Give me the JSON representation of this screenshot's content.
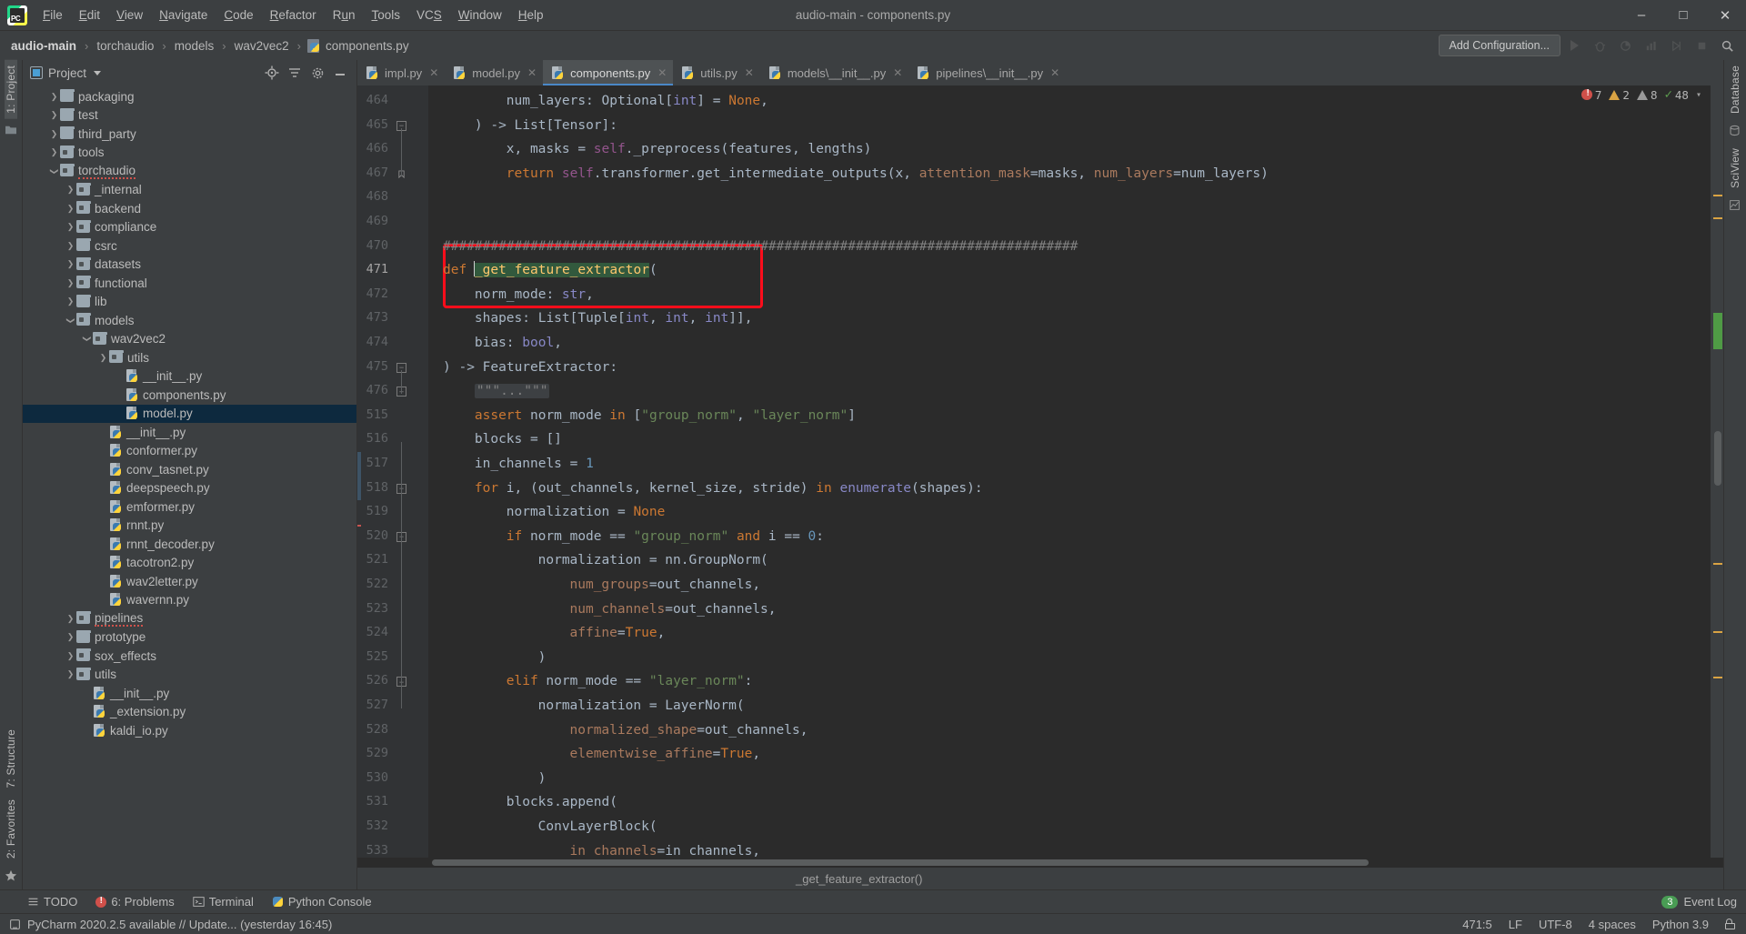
{
  "window": {
    "title": "audio-main - components.py",
    "minimize": "–",
    "maximize": "□",
    "close": "✕"
  },
  "menu": [
    {
      "label": "File"
    },
    {
      "label": "Edit"
    },
    {
      "label": "View"
    },
    {
      "label": "Navigate"
    },
    {
      "label": "Code"
    },
    {
      "label": "Refactor"
    },
    {
      "label": "Run"
    },
    {
      "label": "Tools"
    },
    {
      "label": "VCS"
    },
    {
      "label": "Window"
    },
    {
      "label": "Help"
    }
  ],
  "breadcrumb": {
    "items": [
      "audio-main",
      "torchaudio",
      "models",
      "wav2vec2",
      "components.py"
    ],
    "separator": "›"
  },
  "navbar": {
    "add_configuration": "Add Configuration...",
    "icons": [
      "run-icon",
      "debug-icon",
      "run-coverage-icon",
      "profile-icon",
      "run-with-icon",
      "stop-icon",
      "search-everywhere-icon"
    ]
  },
  "left_rail": {
    "project_label": "1: Project",
    "structure_label": "7: Structure",
    "favorites_label": "2: Favorites"
  },
  "project_panel": {
    "title": "Project",
    "actions": [
      "locate-icon",
      "collapse-all-icon",
      "settings-icon",
      "hide-icon"
    ],
    "tree": [
      {
        "label": "packaging",
        "depth": 1,
        "type": "folder",
        "state": "collapsed"
      },
      {
        "label": "test",
        "depth": 1,
        "type": "folder",
        "state": "collapsed"
      },
      {
        "label": "third_party",
        "depth": 1,
        "type": "folder",
        "state": "collapsed"
      },
      {
        "label": "tools",
        "depth": 1,
        "type": "source",
        "state": "collapsed"
      },
      {
        "label": "torchaudio",
        "depth": 1,
        "type": "source",
        "state": "expanded",
        "spell": true
      },
      {
        "label": "_internal",
        "depth": 2,
        "type": "source",
        "state": "collapsed"
      },
      {
        "label": "backend",
        "depth": 2,
        "type": "source",
        "state": "collapsed"
      },
      {
        "label": "compliance",
        "depth": 2,
        "type": "source",
        "state": "collapsed"
      },
      {
        "label": "csrc",
        "depth": 2,
        "type": "folder",
        "state": "collapsed"
      },
      {
        "label": "datasets",
        "depth": 2,
        "type": "source",
        "state": "collapsed"
      },
      {
        "label": "functional",
        "depth": 2,
        "type": "source",
        "state": "collapsed"
      },
      {
        "label": "lib",
        "depth": 2,
        "type": "folder",
        "state": "collapsed"
      },
      {
        "label": "models",
        "depth": 2,
        "type": "source",
        "state": "expanded"
      },
      {
        "label": "wav2vec2",
        "depth": 3,
        "type": "source",
        "state": "expanded"
      },
      {
        "label": "utils",
        "depth": 4,
        "type": "source",
        "state": "collapsed"
      },
      {
        "label": "__init__.py",
        "depth": 5,
        "type": "python",
        "state": "leaf"
      },
      {
        "label": "components.py",
        "depth": 5,
        "type": "python",
        "state": "leaf"
      },
      {
        "label": "model.py",
        "depth": 5,
        "type": "python",
        "state": "leaf",
        "selected": true
      },
      {
        "label": "__init__.py",
        "depth": 4,
        "type": "python",
        "state": "leaf"
      },
      {
        "label": "conformer.py",
        "depth": 4,
        "type": "python",
        "state": "leaf"
      },
      {
        "label": "conv_tasnet.py",
        "depth": 4,
        "type": "python",
        "state": "leaf"
      },
      {
        "label": "deepspeech.py",
        "depth": 4,
        "type": "python",
        "state": "leaf"
      },
      {
        "label": "emformer.py",
        "depth": 4,
        "type": "python",
        "state": "leaf"
      },
      {
        "label": "rnnt.py",
        "depth": 4,
        "type": "python",
        "state": "leaf"
      },
      {
        "label": "rnnt_decoder.py",
        "depth": 4,
        "type": "python",
        "state": "leaf"
      },
      {
        "label": "tacotron2.py",
        "depth": 4,
        "type": "python",
        "state": "leaf"
      },
      {
        "label": "wav2letter.py",
        "depth": 4,
        "type": "python",
        "state": "leaf"
      },
      {
        "label": "wavernn.py",
        "depth": 4,
        "type": "python",
        "state": "leaf"
      },
      {
        "label": "pipelines",
        "depth": 2,
        "type": "source",
        "state": "collapsed",
        "spell": true
      },
      {
        "label": "prototype",
        "depth": 2,
        "type": "folder",
        "state": "collapsed"
      },
      {
        "label": "sox_effects",
        "depth": 2,
        "type": "source",
        "state": "collapsed"
      },
      {
        "label": "utils",
        "depth": 2,
        "type": "source",
        "state": "collapsed"
      },
      {
        "label": "__init__.py",
        "depth": 3,
        "type": "python",
        "state": "leaf"
      },
      {
        "label": "_extension.py",
        "depth": 3,
        "type": "python",
        "state": "leaf"
      },
      {
        "label": "kaldi_io.py",
        "depth": 3,
        "type": "python",
        "state": "leaf"
      }
    ]
  },
  "editor": {
    "tabs": [
      {
        "label": "impl.py",
        "active": false
      },
      {
        "label": "model.py",
        "active": false
      },
      {
        "label": "components.py",
        "active": true
      },
      {
        "label": "utils.py",
        "active": false
      },
      {
        "label": "models\\__init__.py",
        "active": false
      },
      {
        "label": "pipelines\\__init__.py",
        "active": false
      }
    ],
    "inspection": {
      "errors": "7",
      "warnings": "2",
      "weak_warnings": "8",
      "ok_count": "48"
    },
    "bottom_breadcrumb": "_get_feature_extractor()",
    "lines": [
      {
        "n": "464",
        "indent": 8,
        "fold": "",
        "tokens": [
          {
            "t": "num_layers: ",
            "c": "plain"
          },
          {
            "t": "Optional",
            "c": "plain"
          },
          {
            "t": "[",
            "c": "plain"
          },
          {
            "t": "int",
            "c": "builtin"
          },
          {
            "t": "] = ",
            "c": "plain"
          },
          {
            "t": "None",
            "c": "kw"
          },
          {
            "t": ",",
            "c": "plain"
          }
        ]
      },
      {
        "n": "465",
        "indent": 4,
        "fold": "minus",
        "tokens": [
          {
            "t": ") -> List[Tensor]:",
            "c": "plain"
          }
        ]
      },
      {
        "n": "466",
        "indent": 8,
        "fold": "",
        "tokens": [
          {
            "t": "x, masks = ",
            "c": "plain"
          },
          {
            "t": "self",
            "c": "self"
          },
          {
            "t": "._preprocess(features, lengths)",
            "c": "plain"
          }
        ]
      },
      {
        "n": "467",
        "indent": 8,
        "fold": "end",
        "tokens": [
          {
            "t": "return ",
            "c": "kw"
          },
          {
            "t": "self",
            "c": "self"
          },
          {
            "t": ".transformer.get_intermediate_outputs(x, ",
            "c": "plain"
          },
          {
            "t": "attention_mask",
            "c": "param"
          },
          {
            "t": "=masks, ",
            "c": "plain"
          },
          {
            "t": "num_layers",
            "c": "param"
          },
          {
            "t": "=num_layers)",
            "c": "plain"
          }
        ]
      },
      {
        "n": "468",
        "indent": 0,
        "fold": "",
        "tokens": []
      },
      {
        "n": "469",
        "indent": 0,
        "fold": "",
        "tokens": []
      },
      {
        "n": "470",
        "indent": 0,
        "fold": "",
        "tokens": [
          {
            "t": "################################################################################",
            "c": "comment"
          }
        ]
      },
      {
        "n": "471",
        "indent": 0,
        "fold": "",
        "cur": true,
        "tokens": [
          {
            "t": "def ",
            "c": "kw"
          },
          {
            "t": "_get_feature_extractor",
            "c": "defhl"
          },
          {
            "t": "(",
            "c": "plain"
          }
        ]
      },
      {
        "n": "472",
        "indent": 4,
        "fold": "",
        "tokens": [
          {
            "t": "norm_mode: ",
            "c": "plain"
          },
          {
            "t": "str",
            "c": "builtin"
          },
          {
            "t": ",",
            "c": "plain"
          }
        ]
      },
      {
        "n": "473",
        "indent": 4,
        "fold": "",
        "tokens": [
          {
            "t": "shapes: List[Tuple[",
            "c": "plain"
          },
          {
            "t": "int",
            "c": "builtin"
          },
          {
            "t": ", ",
            "c": "plain"
          },
          {
            "t": "int",
            "c": "builtin"
          },
          {
            "t": ", ",
            "c": "plain"
          },
          {
            "t": "int",
            "c": "builtin"
          },
          {
            "t": "]],",
            "c": "plain"
          }
        ]
      },
      {
        "n": "474",
        "indent": 4,
        "fold": "",
        "tokens": [
          {
            "t": "bias: ",
            "c": "plain"
          },
          {
            "t": "bool",
            "c": "builtin"
          },
          {
            "t": ",",
            "c": "plain"
          }
        ]
      },
      {
        "n": "475",
        "indent": 0,
        "fold": "minus",
        "tokens": [
          {
            "t": ") -> FeatureExtractor:",
            "c": "plain"
          }
        ]
      },
      {
        "n": "476",
        "indent": 4,
        "fold": "plus",
        "tokens": [
          {
            "t": "\"\"\"...\"\"\"",
            "c": "folded"
          }
        ]
      },
      {
        "n": "515",
        "indent": 4,
        "fold": "",
        "tokens": [
          {
            "t": "assert ",
            "c": "kw"
          },
          {
            "t": "norm_mode ",
            "c": "plain"
          },
          {
            "t": "in ",
            "c": "kw"
          },
          {
            "t": "[",
            "c": "plain"
          },
          {
            "t": "\"group_norm\"",
            "c": "str"
          },
          {
            "t": ", ",
            "c": "plain"
          },
          {
            "t": "\"layer_norm\"",
            "c": "str"
          },
          {
            "t": "]",
            "c": "plain"
          }
        ]
      },
      {
        "n": "516",
        "indent": 4,
        "fold": "",
        "tokens": [
          {
            "t": "blocks = []",
            "c": "plain"
          }
        ]
      },
      {
        "n": "517",
        "indent": 4,
        "fold": "",
        "tokens": [
          {
            "t": "in_channels = ",
            "c": "plain"
          },
          {
            "t": "1",
            "c": "num"
          }
        ]
      },
      {
        "n": "518",
        "indent": 4,
        "fold": "minus",
        "tokens": [
          {
            "t": "for ",
            "c": "kw"
          },
          {
            "t": "i, (out_channels, kernel_size, stride) ",
            "c": "plain"
          },
          {
            "t": "in ",
            "c": "kw"
          },
          {
            "t": "enumerate",
            "c": "builtin"
          },
          {
            "t": "(shapes):",
            "c": "plain"
          }
        ]
      },
      {
        "n": "519",
        "indent": 8,
        "fold": "",
        "tokens": [
          {
            "t": "normalization = ",
            "c": "plain"
          },
          {
            "t": "None",
            "c": "kw"
          }
        ]
      },
      {
        "n": "520",
        "indent": 8,
        "fold": "minus",
        "tokens": [
          {
            "t": "if ",
            "c": "kw"
          },
          {
            "t": "norm_mode == ",
            "c": "plain"
          },
          {
            "t": "\"group_norm\"",
            "c": "str"
          },
          {
            "t": " and ",
            "c": "kw"
          },
          {
            "t": "i == ",
            "c": "plain"
          },
          {
            "t": "0",
            "c": "num"
          },
          {
            "t": ":",
            "c": "plain"
          }
        ]
      },
      {
        "n": "521",
        "indent": 12,
        "fold": "",
        "tokens": [
          {
            "t": "normalization = nn.GroupNorm(",
            "c": "plain"
          }
        ]
      },
      {
        "n": "522",
        "indent": 16,
        "fold": "",
        "tokens": [
          {
            "t": "num_groups",
            "c": "param"
          },
          {
            "t": "=out_channels,",
            "c": "plain"
          }
        ]
      },
      {
        "n": "523",
        "indent": 16,
        "fold": "",
        "tokens": [
          {
            "t": "num_channels",
            "c": "param"
          },
          {
            "t": "=out_channels,",
            "c": "plain"
          }
        ]
      },
      {
        "n": "524",
        "indent": 16,
        "fold": "",
        "tokens": [
          {
            "t": "affine",
            "c": "param"
          },
          {
            "t": "=",
            "c": "plain"
          },
          {
            "t": "True",
            "c": "kw"
          },
          {
            "t": ",",
            "c": "plain"
          }
        ]
      },
      {
        "n": "525",
        "indent": 12,
        "fold": "",
        "tokens": [
          {
            "t": ")",
            "c": "plain"
          }
        ]
      },
      {
        "n": "526",
        "indent": 8,
        "fold": "minus",
        "tokens": [
          {
            "t": "elif ",
            "c": "kw"
          },
          {
            "t": "norm_mode == ",
            "c": "plain"
          },
          {
            "t": "\"layer_norm\"",
            "c": "str"
          },
          {
            "t": ":",
            "c": "plain"
          }
        ]
      },
      {
        "n": "527",
        "indent": 12,
        "fold": "",
        "tokens": [
          {
            "t": "normalization = LayerNorm(",
            "c": "plain"
          }
        ]
      },
      {
        "n": "528",
        "indent": 16,
        "fold": "",
        "tokens": [
          {
            "t": "normalized_shape",
            "c": "param"
          },
          {
            "t": "=out_channels,",
            "c": "plain"
          }
        ]
      },
      {
        "n": "529",
        "indent": 16,
        "fold": "",
        "tokens": [
          {
            "t": "elementwise_affine",
            "c": "param"
          },
          {
            "t": "=",
            "c": "plain"
          },
          {
            "t": "True",
            "c": "kw"
          },
          {
            "t": ",",
            "c": "plain"
          }
        ]
      },
      {
        "n": "530",
        "indent": 12,
        "fold": "",
        "tokens": [
          {
            "t": ")",
            "c": "plain"
          }
        ]
      },
      {
        "n": "531",
        "indent": 8,
        "fold": "",
        "tokens": [
          {
            "t": "blocks.append(",
            "c": "plain"
          }
        ]
      },
      {
        "n": "532",
        "indent": 12,
        "fold": "",
        "tokens": [
          {
            "t": "ConvLayerBlock(",
            "c": "plain"
          }
        ]
      },
      {
        "n": "533",
        "indent": 16,
        "fold": "",
        "tokens": [
          {
            "t": "in_channels",
            "c": "param"
          },
          {
            "t": "=in_channels,",
            "c": "plain"
          }
        ]
      }
    ]
  },
  "right_rail": {
    "database_label": "Database",
    "scipview_label": "SciView"
  },
  "toolwindows": [
    {
      "label": "TODO",
      "icon": "todo-icon"
    },
    {
      "label": "6: Problems",
      "icon": "problems-icon"
    },
    {
      "label": "Terminal",
      "icon": "terminal-icon"
    },
    {
      "label": "Python Console",
      "icon": "python-console-icon"
    }
  ],
  "event_log": {
    "count": "3",
    "label": "Event Log"
  },
  "statusbar": {
    "message": "PyCharm 2020.2.5 available // Update... (yesterday 16:45)",
    "caret": "471:5",
    "line_sep": "LF",
    "encoding": "UTF-8",
    "indent": "4 spaces",
    "interpreter": "Python 3.9"
  }
}
